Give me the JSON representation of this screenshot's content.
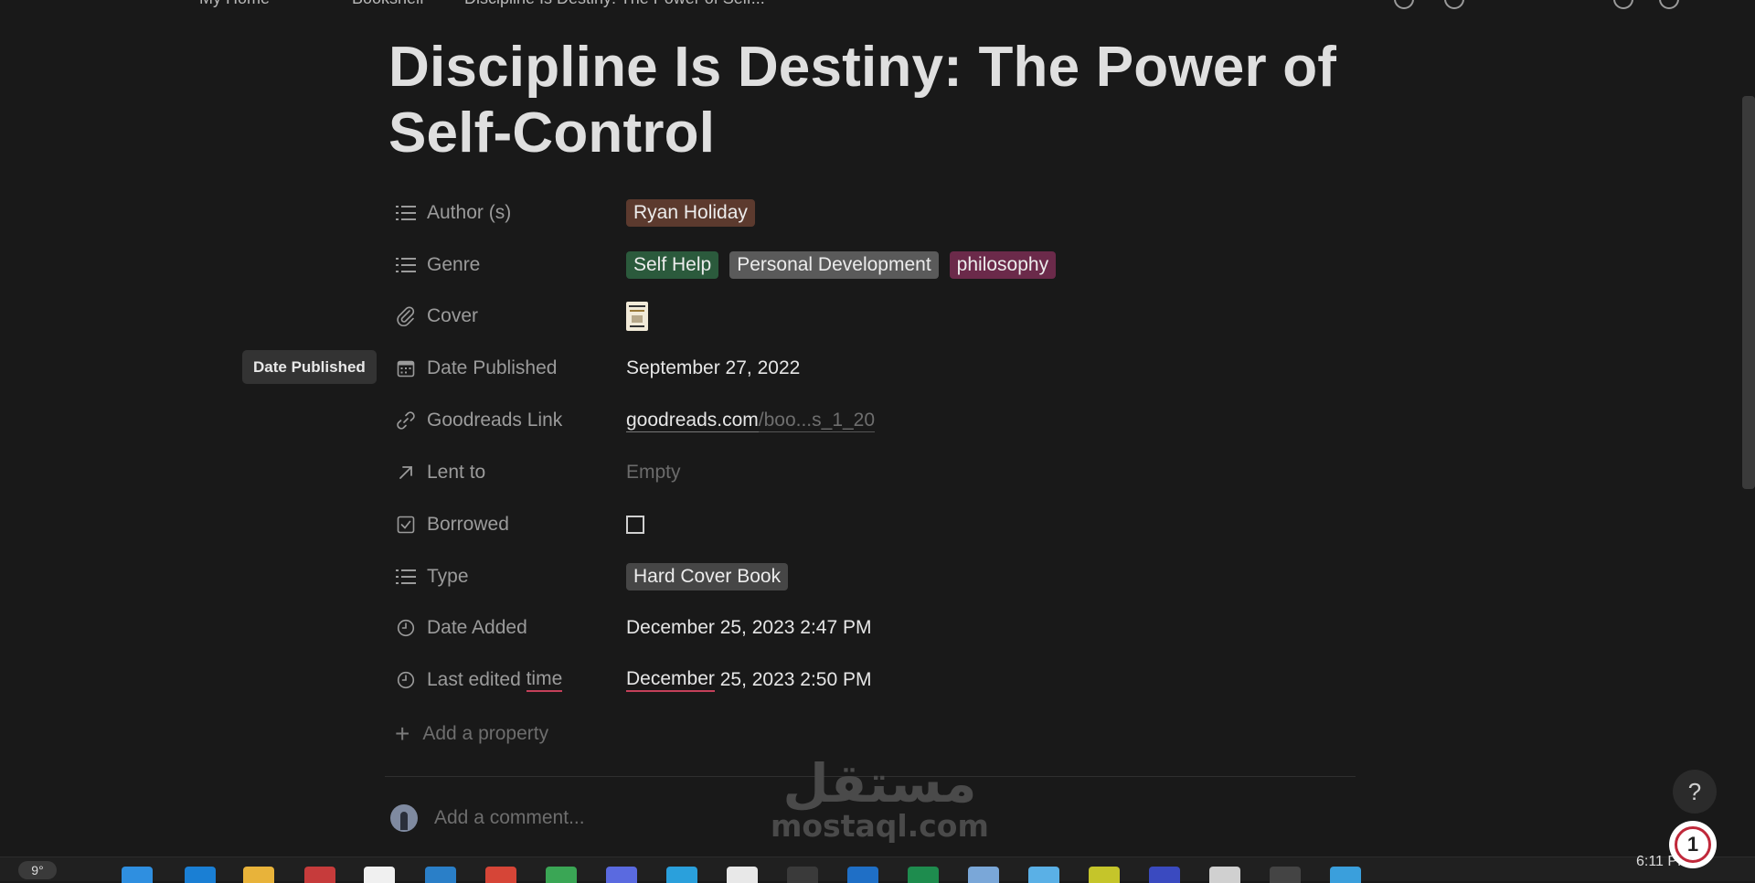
{
  "topbar": {
    "crumbs": [
      "My Home",
      "Bookshelf",
      "Discipline Is Destiny: The Power of Self..."
    ]
  },
  "page": {
    "title": "Discipline Is Destiny: The Power of Self-Control"
  },
  "properties": {
    "author": {
      "name": "Author (s)",
      "tags": [
        {
          "label": "Ryan Holiday",
          "color": "#5c3a2e"
        }
      ]
    },
    "genre": {
      "name": "Genre",
      "tags": [
        {
          "label": "Self Help",
          "color": "#2b5a3c"
        },
        {
          "label": "Personal Development",
          "color": "#5a5a5a"
        },
        {
          "label": "philosophy",
          "color": "#6b2a4a"
        }
      ]
    },
    "cover": {
      "name": "Cover"
    },
    "date_published": {
      "name": "Date Published",
      "value": "September 27, 2022"
    },
    "goodreads": {
      "name": "Goodreads Link",
      "host": "goodreads.com",
      "rest": "/boo...s_1_20"
    },
    "lent_to": {
      "name": "Lent to",
      "value": "Empty"
    },
    "borrowed": {
      "name": "Borrowed",
      "checked": false
    },
    "type": {
      "name": "Type",
      "tags": [
        {
          "label": "Hard Cover Book",
          "color": "#464646"
        }
      ]
    },
    "date_added": {
      "name": "Date Added",
      "value": "December 25, 2023 2:47 PM"
    },
    "last_edited": {
      "name_part1": "Last edited ",
      "name_part2": "time",
      "value_part1": "December",
      "value_part2": " 25, 2023 2:50 PM"
    }
  },
  "add_property": {
    "label": "Add a property"
  },
  "comment": {
    "placeholder": "Add a comment..."
  },
  "tooltip": {
    "text": "Date Published"
  },
  "help": {
    "label": "?"
  },
  "notification": {
    "count": "1"
  },
  "watermark": {
    "arabic": "مستقل",
    "latin": "mostaql.com"
  },
  "taskbar": {
    "weather": "9°",
    "clock": "6:11 PM"
  }
}
